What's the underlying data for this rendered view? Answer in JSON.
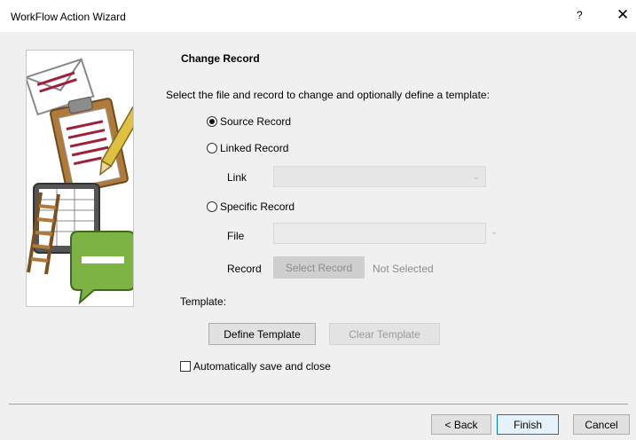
{
  "window": {
    "title": "WorkFlow Action Wizard",
    "help_label": "?",
    "close_label": "✕"
  },
  "wizard": {
    "step_title": "Change Record",
    "instruction": "Select the file and record to change and optionally define a template:"
  },
  "options": {
    "selected": "source",
    "source_label": "Source Record",
    "linked_label": "Linked Record",
    "specific_label": "Specific Record"
  },
  "link": {
    "label": "Link",
    "value": ""
  },
  "file": {
    "label": "File",
    "value": ""
  },
  "record": {
    "label": "Record",
    "button_label": "Select Record",
    "status": "Not Selected"
  },
  "template": {
    "label": "Template:",
    "define_label": "Define Template",
    "clear_label": "Clear Template"
  },
  "auto_save": {
    "label": "Automatically save and close",
    "checked": false
  },
  "footer": {
    "back_label": "< Back",
    "finish_label": "Finish",
    "cancel_label": "Cancel"
  }
}
